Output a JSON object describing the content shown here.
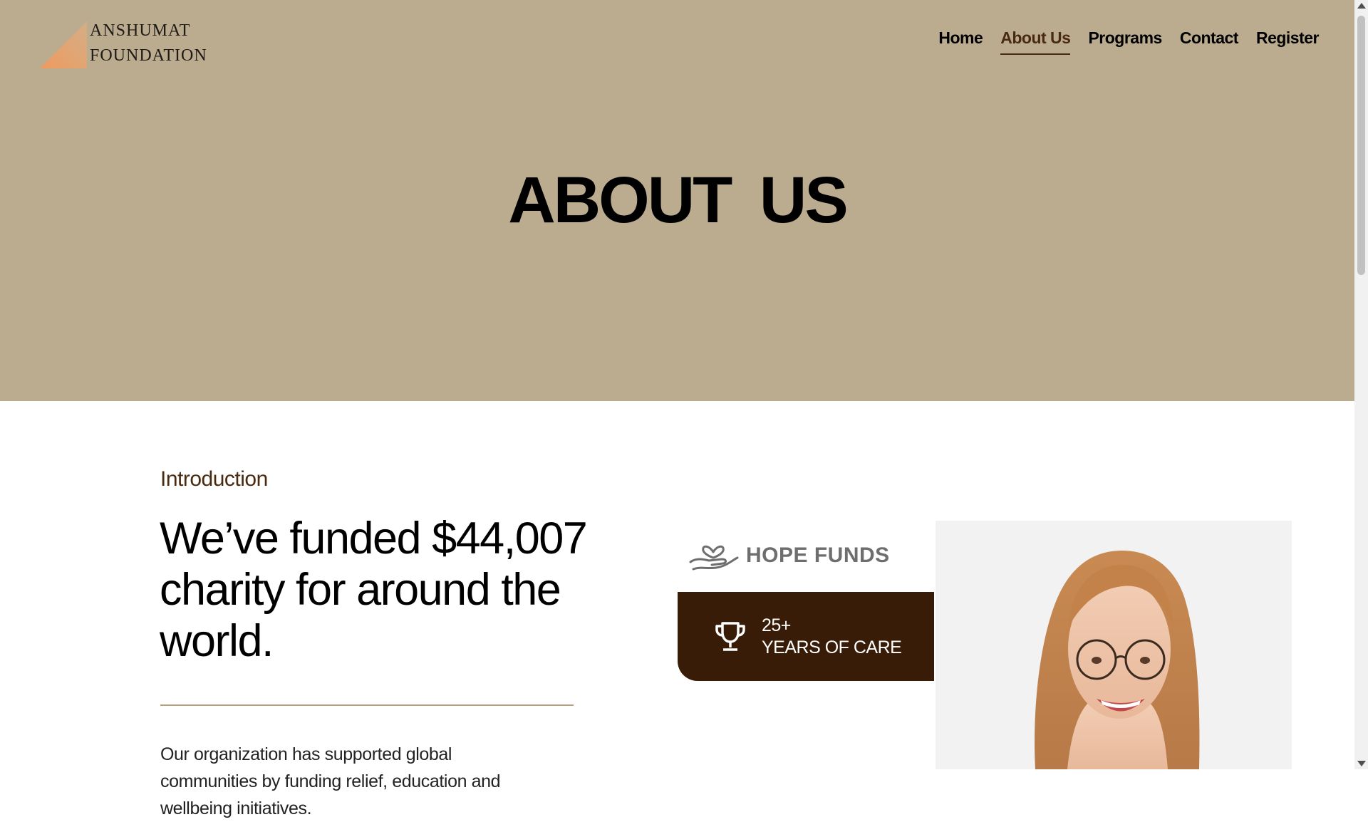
{
  "brand": {
    "line1": "ANSHUMAT",
    "line2": "FOUNDATION",
    "icon": "triangle-logo-icon",
    "gradient": [
      "#e9a877",
      "#c9a07a"
    ]
  },
  "nav": {
    "items": [
      {
        "label": "Home",
        "active": false
      },
      {
        "label": "About Us",
        "active": true
      },
      {
        "label": "Programs",
        "active": false
      },
      {
        "label": "Contact",
        "active": false
      },
      {
        "label": "Register",
        "active": false
      }
    ]
  },
  "hero": {
    "title": "ABOUT US"
  },
  "intro": {
    "eyebrow": "Introduction",
    "heading": "We’ve funded $44,007 charity for around the world.",
    "body": "Our organization has supported global communities by funding relief, education and wellbeing initiatives."
  },
  "hope_logo": {
    "text": "HOPE FUNDS",
    "icon": "heart-hand-icon"
  },
  "care_card": {
    "icon": "trophy-icon",
    "count": "25+",
    "label": "YEARS OF CARE"
  },
  "portrait": {
    "icon": "woman-portrait"
  },
  "colors": {
    "hero_background": "#bbab8f",
    "accent_dark_brown": "#391c07",
    "active_nav": "#4a2a0f",
    "divider": "#b59f7c"
  }
}
